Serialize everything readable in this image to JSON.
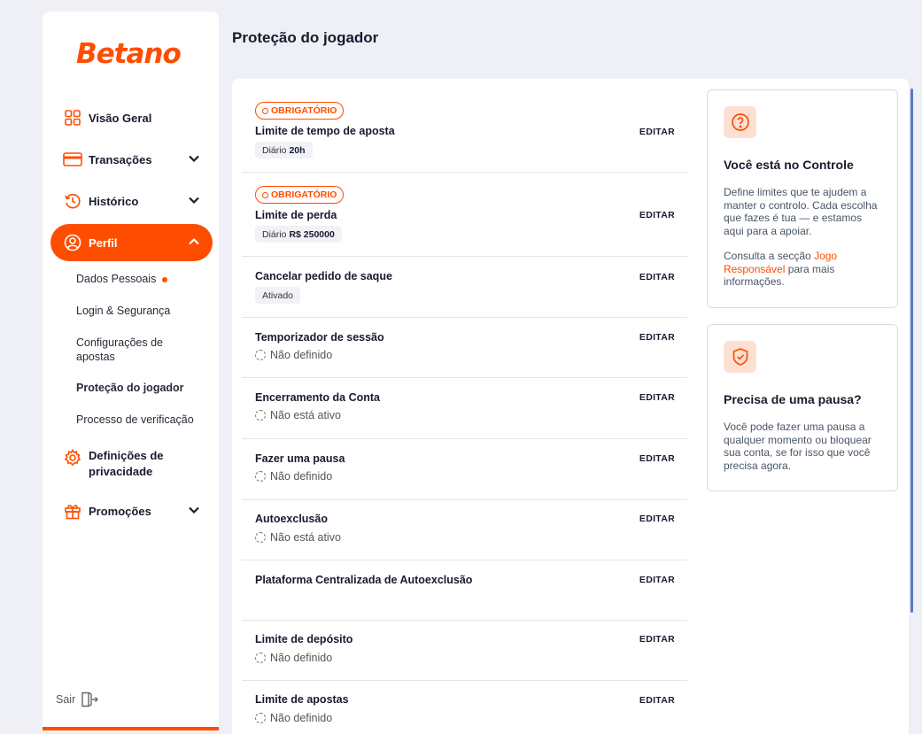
{
  "brand": {
    "logo_text": "Betano",
    "accent": "#ff4d00"
  },
  "sidebar": {
    "items": [
      {
        "label": "Visão Geral",
        "icon": "grid-icon"
      },
      {
        "label": "Transações",
        "icon": "card-icon"
      },
      {
        "label": "Histórico",
        "icon": "history-icon"
      },
      {
        "label": "Perfil",
        "icon": "user-circle-icon"
      },
      {
        "label": "Definições de privacidade",
        "icon": "gear-icon"
      },
      {
        "label": "Promoções",
        "icon": "gift-icon"
      }
    ],
    "profile_sub": [
      {
        "label": "Dados Pessoais"
      },
      {
        "label": "Login & Segurança"
      },
      {
        "label": "Configurações de apostas"
      },
      {
        "label": "Proteção do jogador"
      },
      {
        "label": "Processo de verificação"
      }
    ],
    "logout_label": "Sair"
  },
  "page_title": "Proteção do jogador",
  "edit_label": "EDITAR",
  "required_badge": "OBRIGATÓRIO",
  "rows": [
    {
      "label": "Limite de tempo de aposta",
      "chip_prefix": "Diário",
      "chip_value": "20h"
    },
    {
      "label": "Limite de perda",
      "chip_prefix": "Diário",
      "chip_value": "R$ 250000"
    },
    {
      "label": "Cancelar pedido de saque",
      "chip_text": "Ativado"
    },
    {
      "label": "Temporizador de sessão",
      "status": "Não definido"
    },
    {
      "label": "Encerramento da Conta",
      "status": "Não está ativo"
    },
    {
      "label": "Fazer uma pausa",
      "status": "Não definido"
    },
    {
      "label": "Autoexclusão",
      "status": "Não está ativo"
    },
    {
      "label": "Plataforma Centralizada de Autoexclusão"
    },
    {
      "label": "Limite de depósito",
      "status": "Não definido"
    },
    {
      "label": "Limite de apostas",
      "status": "Não definido"
    }
  ],
  "cards": [
    {
      "title": "Você está no Controle",
      "text": "Define limites que te ajudem a manter o controlo. Cada escolha que fazes é tua — e estamos aqui para a apoiar.",
      "text2_prefix": "Consulta a secção ",
      "text2_link": "Jogo Responsável",
      "text2_suffix": " para mais informações.",
      "icon": "question-icon"
    },
    {
      "title": "Precisa de uma pausa?",
      "text": "Você pode fazer uma pausa a qualquer momento ou bloquear sua conta, se for isso que você precisa agora.",
      "icon": "shield-icon"
    }
  ]
}
